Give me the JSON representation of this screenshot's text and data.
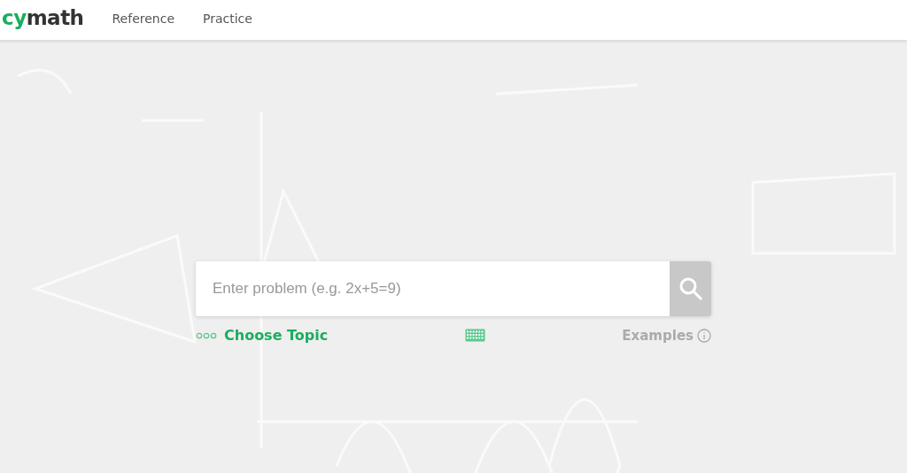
{
  "logo": {
    "accent": "cy",
    "rest": "math"
  },
  "nav": [
    {
      "label": "Reference"
    },
    {
      "label": "Practice"
    }
  ],
  "search": {
    "placeholder": "Enter problem (e.g. 2x+5=9)"
  },
  "links": {
    "topic": "Choose Topic",
    "examples": "Examples"
  }
}
